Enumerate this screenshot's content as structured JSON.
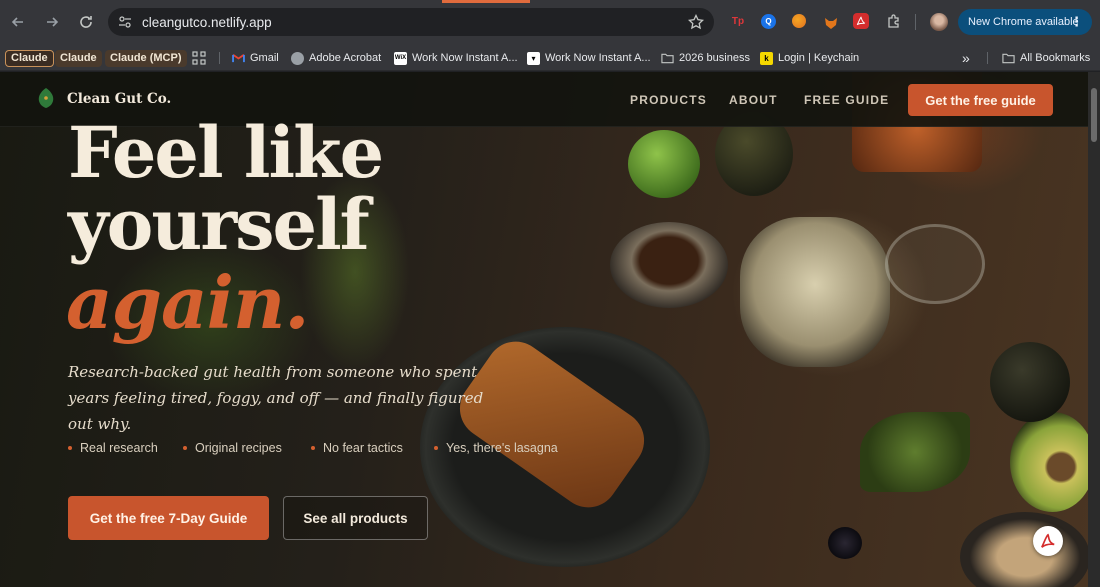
{
  "browser": {
    "url": "cleangutco.netlify.app",
    "update_label": "New Chrome available",
    "extensions": [
      "Tp",
      "Q",
      "",
      "",
      "",
      ""
    ]
  },
  "bookmarks": {
    "pill_claude": "Claude",
    "claude": "Claude",
    "claude_mcp": "Claude (MCP)",
    "gmail": "Gmail",
    "acrobat": "Adobe Acrobat",
    "work1": "Work Now Instant A...",
    "work2": "Work Now Instant A...",
    "business": "2026 business",
    "keychain": "Login | Keychain",
    "more": "»",
    "all": "All Bookmarks"
  },
  "site": {
    "brand": "Clean Gut Co.",
    "nav": {
      "products": "PRODUCTS",
      "about": "ABOUT",
      "free_guide": "FREE GUIDE",
      "cta": "Get the free guide"
    },
    "hero": {
      "line1": "Feel like",
      "line2": "yourself",
      "accent": "again.",
      "sub": "Research-backed gut health from someone who spent years feeling tired, foggy, and off — and finally figured out why.",
      "features": [
        "Real research",
        "Original recipes",
        "No fear tactics",
        "Yes, there's lasagna"
      ],
      "cta_primary": "Get the free 7-Day Guide",
      "cta_secondary": "See all products"
    }
  },
  "colors": {
    "accent": "#c8552d",
    "cream": "#f5ecdc",
    "chrome_bg": "#35363a"
  }
}
